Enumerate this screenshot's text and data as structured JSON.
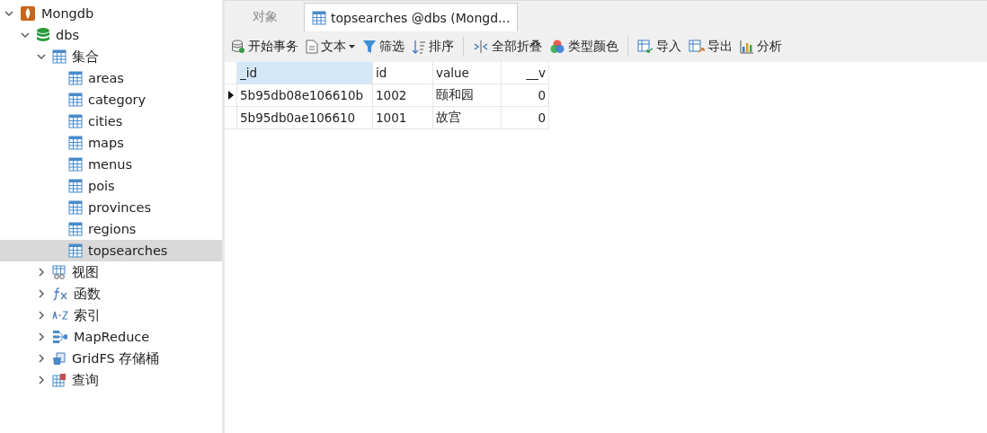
{
  "sidebar": {
    "tree": [
      {
        "label": "Mongdb",
        "kind": "server",
        "expanded": true,
        "selected": false,
        "children": [
          {
            "label": "dbs",
            "kind": "database",
            "expanded": true,
            "selected": false,
            "children": [
              {
                "label": "集合",
                "kind": "table",
                "expanded": true,
                "selected": false,
                "children": [
                  {
                    "label": "areas",
                    "kind": "table",
                    "selected": false
                  },
                  {
                    "label": "category",
                    "kind": "table",
                    "selected": false
                  },
                  {
                    "label": "cities",
                    "kind": "table",
                    "selected": false
                  },
                  {
                    "label": "maps",
                    "kind": "table",
                    "selected": false
                  },
                  {
                    "label": "menus",
                    "kind": "table",
                    "selected": false
                  },
                  {
                    "label": "pois",
                    "kind": "table",
                    "selected": false
                  },
                  {
                    "label": "provinces",
                    "kind": "table",
                    "selected": false
                  },
                  {
                    "label": "regions",
                    "kind": "table",
                    "selected": false
                  },
                  {
                    "label": "topsearches",
                    "kind": "table",
                    "selected": true
                  }
                ]
              },
              {
                "label": "视图",
                "kind": "view",
                "expanded": false,
                "selected": false
              },
              {
                "label": "函数",
                "kind": "function",
                "expanded": false,
                "selected": false
              },
              {
                "label": "索引",
                "kind": "index",
                "expanded": false,
                "selected": false
              },
              {
                "label": "MapReduce",
                "kind": "mapreduce",
                "expanded": false,
                "selected": false
              },
              {
                "label": "GridFS 存储桶",
                "kind": "gridfs",
                "expanded": false,
                "selected": false
              },
              {
                "label": "查询",
                "kind": "query",
                "expanded": false,
                "selected": false
              }
            ]
          }
        ]
      }
    ]
  },
  "tabs": [
    {
      "label": "对象",
      "kind": "objects",
      "selected": false
    },
    {
      "label": "topsearches @dbs (Mongd...",
      "kind": "collection",
      "selected": true
    }
  ],
  "toolbar": {
    "groups": [
      {
        "buttons": [
          {
            "label": "开始事务",
            "kind": "transaction",
            "dropdown": false
          },
          {
            "label": "文本",
            "kind": "text",
            "dropdown": true
          },
          {
            "label": "筛选",
            "kind": "filter",
            "dropdown": false
          },
          {
            "label": "排序",
            "kind": "sort",
            "dropdown": false
          }
        ]
      },
      {
        "buttons": [
          {
            "label": "全部折叠",
            "kind": "collapse",
            "dropdown": false
          },
          {
            "label": "类型颜色",
            "kind": "color",
            "dropdown": false
          }
        ]
      },
      {
        "buttons": [
          {
            "label": "导入",
            "kind": "import",
            "dropdown": false
          },
          {
            "label": "导出",
            "kind": "export",
            "dropdown": false
          },
          {
            "label": "分析",
            "kind": "chart",
            "dropdown": false
          }
        ]
      }
    ]
  },
  "table": {
    "columns": [
      {
        "label": "_id",
        "selected": true
      },
      {
        "label": "id",
        "selected": false
      },
      {
        "label": "value",
        "selected": false
      },
      {
        "label": "__v",
        "selected": false
      }
    ],
    "rows": [
      {
        "current": true,
        "cells": [
          "5b95db08e106610b",
          "1002",
          "颐和园",
          "0"
        ]
      },
      {
        "current": false,
        "cells": [
          "5b95db0ae106610",
          "1001",
          "故宫",
          "0"
        ]
      }
    ]
  }
}
